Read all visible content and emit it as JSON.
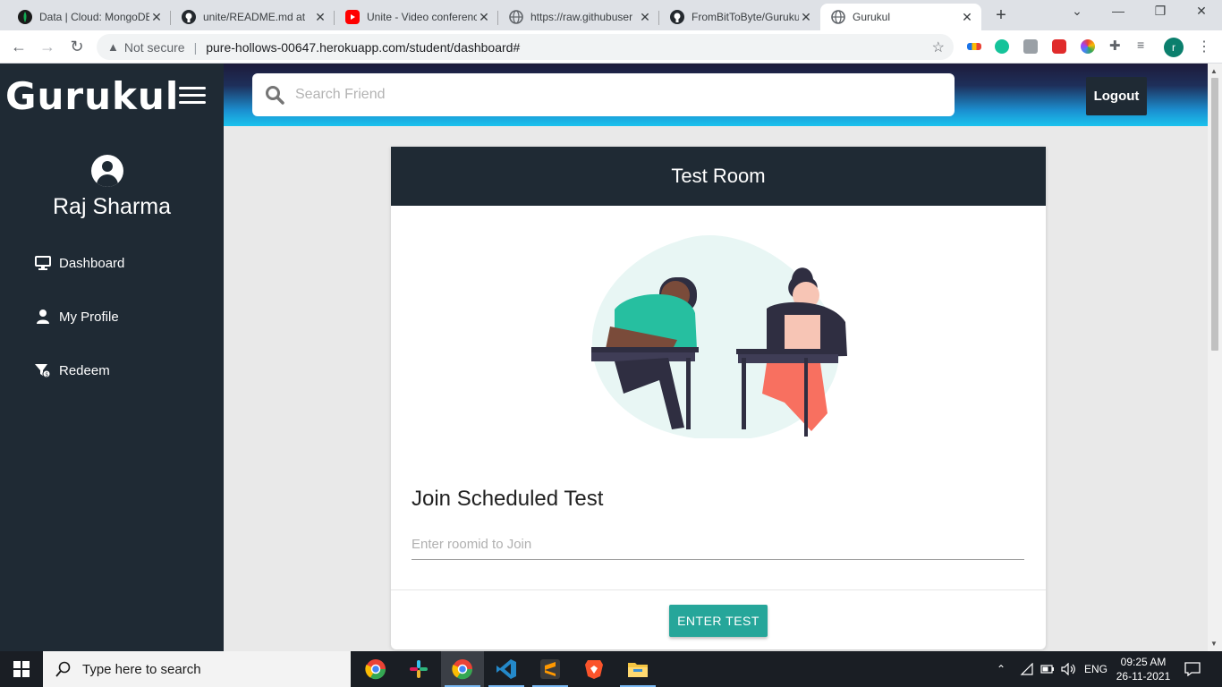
{
  "browser": {
    "tabs": [
      {
        "title": "Data | Cloud: MongoDB",
        "favicon": "mongodb-leaf-icon",
        "color": "#13aa52"
      },
      {
        "title": "unite/README.md at",
        "favicon": "github-icon",
        "color": "#24292e"
      },
      {
        "title": "Unite - Video conference",
        "favicon": "youtube-icon",
        "color": "#ff0000"
      },
      {
        "title": "https://raw.githubuser",
        "favicon": "globe-icon",
        "color": "#5f6368"
      },
      {
        "title": "FromBitToByte/Gurukul",
        "favicon": "github-icon",
        "color": "#24292e"
      },
      {
        "title": "Gurukul",
        "favicon": "globe-icon",
        "color": "#5f6368"
      }
    ],
    "security_label": "Not secure",
    "url": "pure-hollows-00647.herokuapp.com/student/dashboard#",
    "profile_initial": "r"
  },
  "app": {
    "brand": "Gurukul",
    "user_name": "Raj Sharma",
    "nav": [
      {
        "label": "Dashboard",
        "icon": "monitor-icon"
      },
      {
        "label": "My Profile",
        "icon": "user-icon"
      },
      {
        "label": "Redeem",
        "icon": "redeem-icon"
      }
    ],
    "search": {
      "placeholder": "Search Friend"
    },
    "logout_label": "Logout",
    "card": {
      "title": "Test Room",
      "join_heading": "Join Scheduled Test",
      "room_placeholder": "Enter roomid to Join",
      "enter_label": "ENTER TEST"
    },
    "colors": {
      "sidebar": "#1f2a34",
      "accent": "#26a69a",
      "topbar_end": "#1bc3ee"
    }
  },
  "taskbar": {
    "search_text": "Type here to search",
    "language": "ENG",
    "time": "09:25 AM",
    "date": "26-11-2021"
  }
}
